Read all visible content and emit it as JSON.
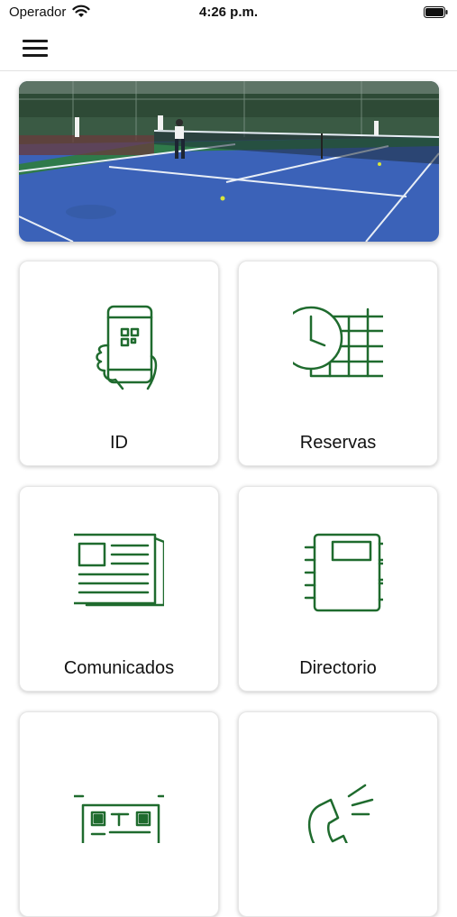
{
  "status_bar": {
    "carrier": "Operador",
    "time": "4:26 p.m."
  },
  "colors": {
    "accent": "#1f6b2e",
    "court_blue": "#3b62b8",
    "court_green": "#2f7a4a"
  },
  "nav": {
    "menu_icon": "hamburger-menu-icon"
  },
  "banner": {
    "image": "tennis-court-photo"
  },
  "tiles": [
    {
      "label": "ID",
      "icon": "phone-qr-icon"
    },
    {
      "label": "Reservas",
      "icon": "clock-calendar-icon"
    },
    {
      "label": "Comunicados",
      "icon": "newspaper-icon"
    },
    {
      "label": "Directorio",
      "icon": "notebook-icon"
    },
    {
      "label": "",
      "icon": "qr-scan-icon"
    },
    {
      "label": "",
      "icon": "phone-call-icon"
    }
  ]
}
